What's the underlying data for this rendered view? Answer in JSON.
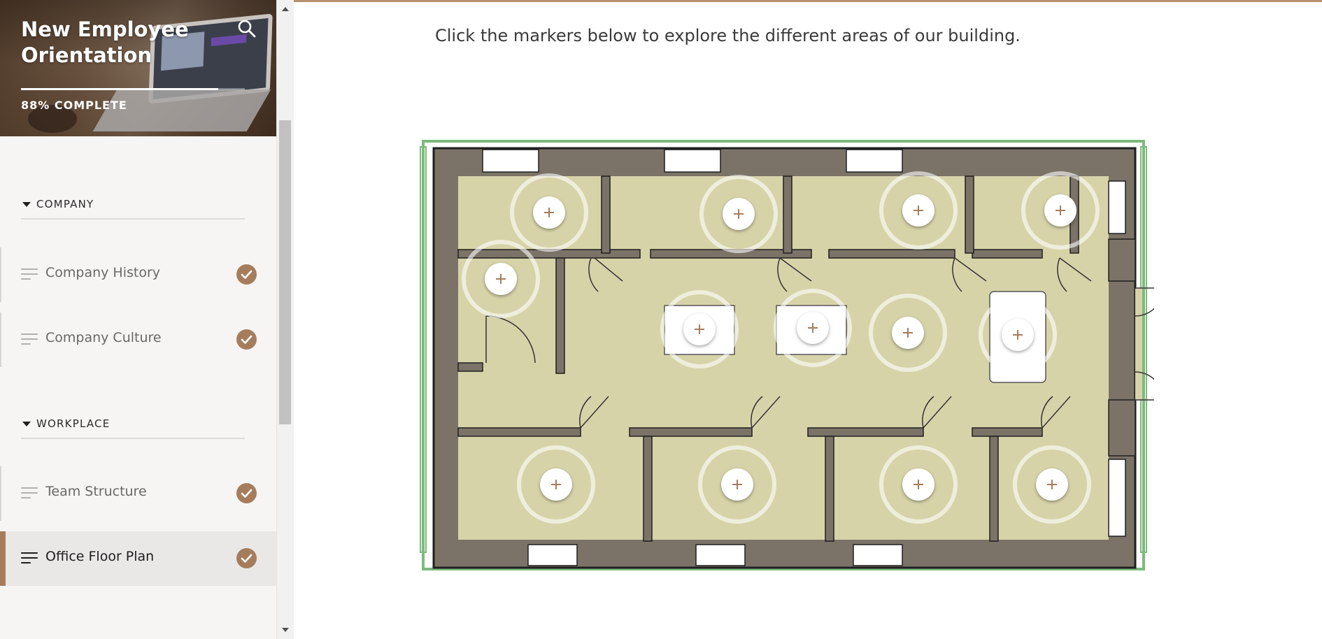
{
  "course": {
    "title_line1": "New Employee",
    "title_line2": "Orientation",
    "progress_percent": 88,
    "progress_label": "88% COMPLETE"
  },
  "sidebar": {
    "sections": [
      {
        "label": "COMPANY",
        "lessons": [
          {
            "title": "Company History",
            "completed": true,
            "active": false
          },
          {
            "title": "Company Culture",
            "completed": true,
            "active": false
          }
        ]
      },
      {
        "label": "WORKPLACE",
        "lessons": [
          {
            "title": "Team Structure",
            "completed": true,
            "active": false
          },
          {
            "title": "Office Floor Plan",
            "completed": true,
            "active": true
          }
        ]
      }
    ]
  },
  "main": {
    "instructions": "Click the markers below to explore the different areas of our building.",
    "marker_count": 13
  },
  "colors": {
    "accent": "#a67d5c",
    "floor": "#d7d3a9",
    "walls": "#7b7367",
    "outline": "#6fb070"
  }
}
